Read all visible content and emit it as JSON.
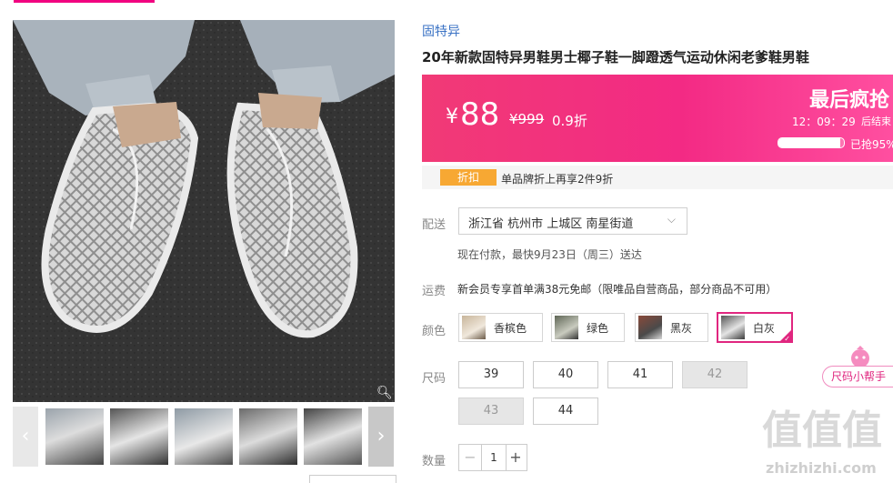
{
  "product": {
    "brand": "固特异",
    "title": "20年新款固特异男鞋男士椰子鞋一脚蹬透气运动休闲老爹鞋男鞋"
  },
  "price": {
    "currency": "¥",
    "current": "88",
    "original": "¥999",
    "discount": "0.9折",
    "banner_title": "最后疯抢",
    "countdown": "12：09：29",
    "countdown_suffix": "后结束",
    "sold_percent": 95,
    "sold_label": "已抢95%"
  },
  "promo": {
    "tag": "折扣",
    "text": "单品牌折上再享2件9折"
  },
  "delivery": {
    "label": "配送",
    "address": "浙江省 杭州市 上城区 南星街道",
    "eta": "现在付款，最快9月23日（周三）送达"
  },
  "shipping": {
    "label": "运费",
    "text": "新会员专享首单满38元免邮（限唯品自营商品，部分商品不可用）"
  },
  "color": {
    "label": "颜色",
    "options": [
      "香槟色",
      "绿色",
      "黑灰",
      "白灰"
    ],
    "selected": "白灰"
  },
  "size": {
    "label": "尺码",
    "options": [
      "39",
      "40",
      "41",
      "42",
      "43",
      "44"
    ],
    "disabled": [
      "42",
      "43"
    ],
    "helper": "尺码小帮手"
  },
  "quantity": {
    "label": "数量",
    "value": "1",
    "minus": "−",
    "plus": "+"
  },
  "gallery": {
    "prev": "‹",
    "next": "›"
  },
  "watermark": {
    "logo": "值值值",
    "url": "zhizhizhi.com"
  },
  "colors": {
    "accent": "#f10180",
    "price_bg": "#f13a76",
    "promo_tag": "#f7a833",
    "link": "#3b73c5"
  },
  "icons": [
    "zoom-icon",
    "chevron-down-icon",
    "chevron-left-icon",
    "chevron-right-icon",
    "check-icon"
  ]
}
